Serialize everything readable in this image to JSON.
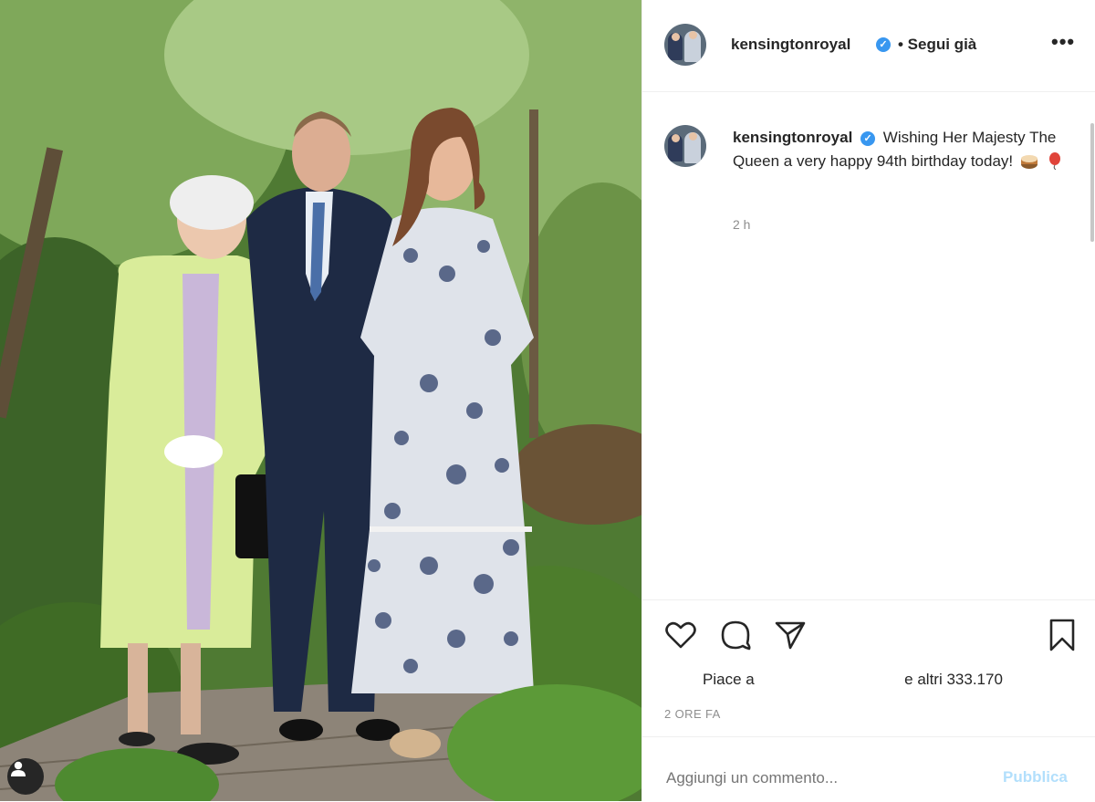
{
  "post": {
    "username": "kensingtonroyal",
    "verified_glyph": "✓",
    "follow_status": "• Segui già",
    "more_glyph": "•••"
  },
  "caption": {
    "username": "kensingtonroyal",
    "text": "Wishing Her Majesty The Queen a very happy 94th birthday today!",
    "emojis": [
      "birthday-cake-emoji",
      "balloon-emoji"
    ],
    "time": "2 h"
  },
  "actions": {
    "icons": [
      "heart-icon",
      "comment-icon",
      "share-icon",
      "bookmark-icon"
    ],
    "likes_prefix": "Piace a",
    "likes_suffix": "e altri 333.170",
    "date": "2 ORE FA"
  },
  "comment": {
    "placeholder": "Aggiungi un commento...",
    "publish_label": "Pubblica"
  },
  "colors": {
    "verified": "#3897f0",
    "publish": "#b2dffc",
    "muted": "#8e8e8e"
  }
}
